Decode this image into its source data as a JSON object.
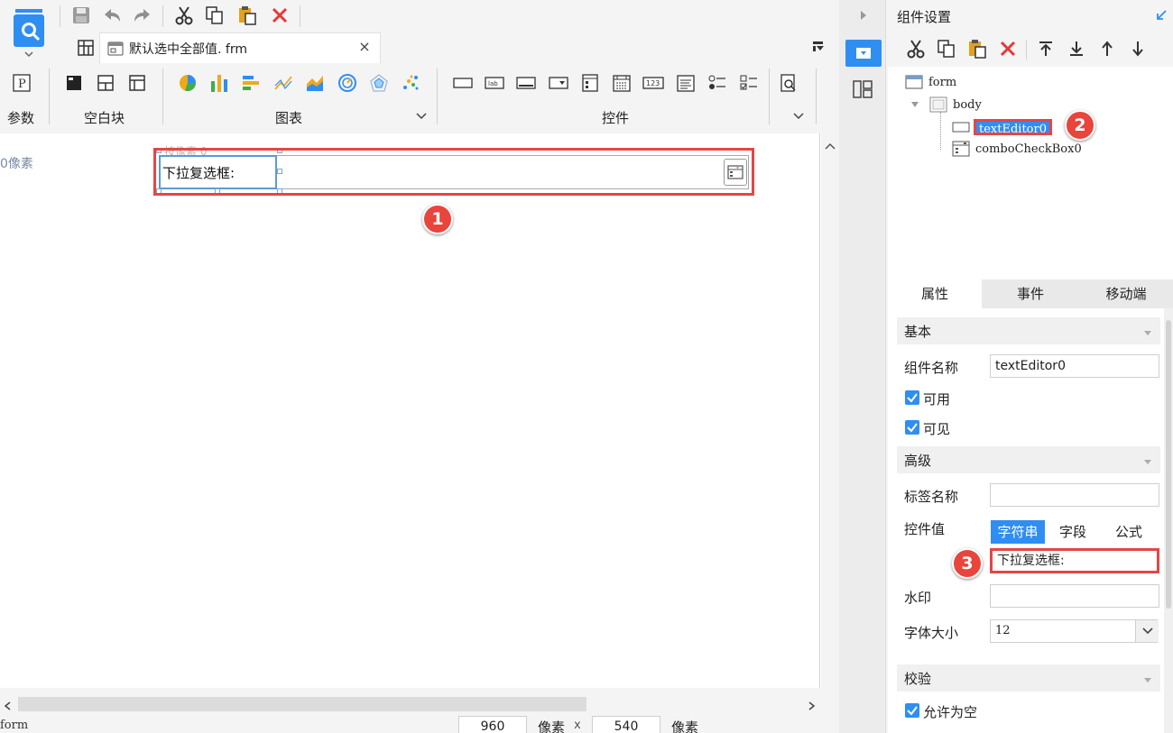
{
  "toolbar": {
    "icons": [
      "save-icon",
      "undo-icon",
      "redo-icon",
      "cut-icon",
      "copy-icon",
      "paste-icon",
      "delete-icon"
    ]
  },
  "file_tab": {
    "name": "默认选中全部值. frm",
    "close": "×"
  },
  "ribbon": {
    "groups": [
      {
        "label": "参数"
      },
      {
        "label": "空白块"
      },
      {
        "label": "图表"
      },
      {
        "label": "控件"
      }
    ]
  },
  "canvas": {
    "pixel_note": "0像素",
    "ghost_label": "按像素 0",
    "component_label": "下拉复选框:",
    "width_value": "960",
    "height_value": "540",
    "unit1": "像素",
    "times": "x",
    "unit2": "像素",
    "status_name": "form"
  },
  "callouts": [
    "1",
    "2",
    "3"
  ],
  "right_panel": {
    "title": "组件设置",
    "tree": {
      "root": "form",
      "body": "body",
      "selected": "textEditor0",
      "combo": "comboCheckBox0"
    },
    "tabs": [
      "属性",
      "事件",
      "移动端"
    ],
    "sections": {
      "basic": "基本",
      "advanced": "高级",
      "validation": "校验"
    },
    "fields": {
      "name_label": "组件名称",
      "name_value": "textEditor0",
      "enabled_label": "可用",
      "visible_label": "可见",
      "tag_label": "标签名称",
      "tag_value": "",
      "value_label": "控件值",
      "value_modes": [
        "字符串",
        "字段",
        "公式"
      ],
      "value_text": "下拉复选框:",
      "watermark_label": "水印",
      "watermark_value": "",
      "font_size_label": "字体大小",
      "font_size_value": "12",
      "allow_empty_label": "允许为空"
    }
  },
  "colors": {
    "accent": "#2f8ef2",
    "highlight_border": "#e64545",
    "callout": "#e8453c",
    "selection_border": "#5b9bd5"
  }
}
